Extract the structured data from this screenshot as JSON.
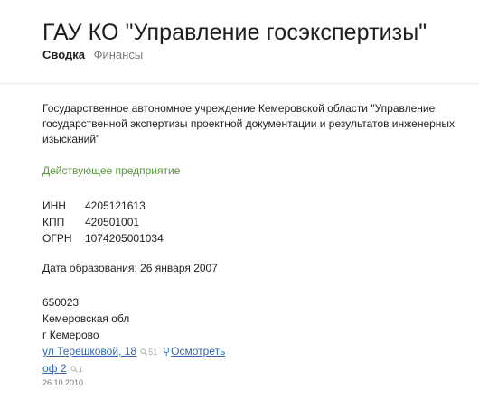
{
  "header": {
    "title": "ГАУ КО \"Управление госэкспертизы\"",
    "tabs": [
      {
        "label": "Сводка",
        "active": true
      },
      {
        "label": "Финансы",
        "active": false
      }
    ]
  },
  "company": {
    "full_name": "Государственное автономное учреждение Кемеровской области \"Управление государственной экспертизы проектной документации и результатов инженерных изысканий\"",
    "status": "Действующее предприятие",
    "identifiers": [
      {
        "label": "ИНН",
        "value": "4205121613"
      },
      {
        "label": "КПП",
        "value": "420501001"
      },
      {
        "label": "ОГРН",
        "value": "1074205001034"
      }
    ],
    "founded": "Дата образования: 26 января 2007"
  },
  "address": {
    "postcode": "650023",
    "region": "Кемеровская обл",
    "city": "г Кемерово",
    "street": "ул Терешковой, 18",
    "street_count": "51",
    "view_link": "Осмотреть",
    "office": "оф 2",
    "office_count": "1"
  },
  "updated_date": "26.10.2010",
  "colors": {
    "status_green": "#5a9a3a",
    "link_blue": "#3366aa",
    "muted_gray": "#7a7a7a"
  }
}
